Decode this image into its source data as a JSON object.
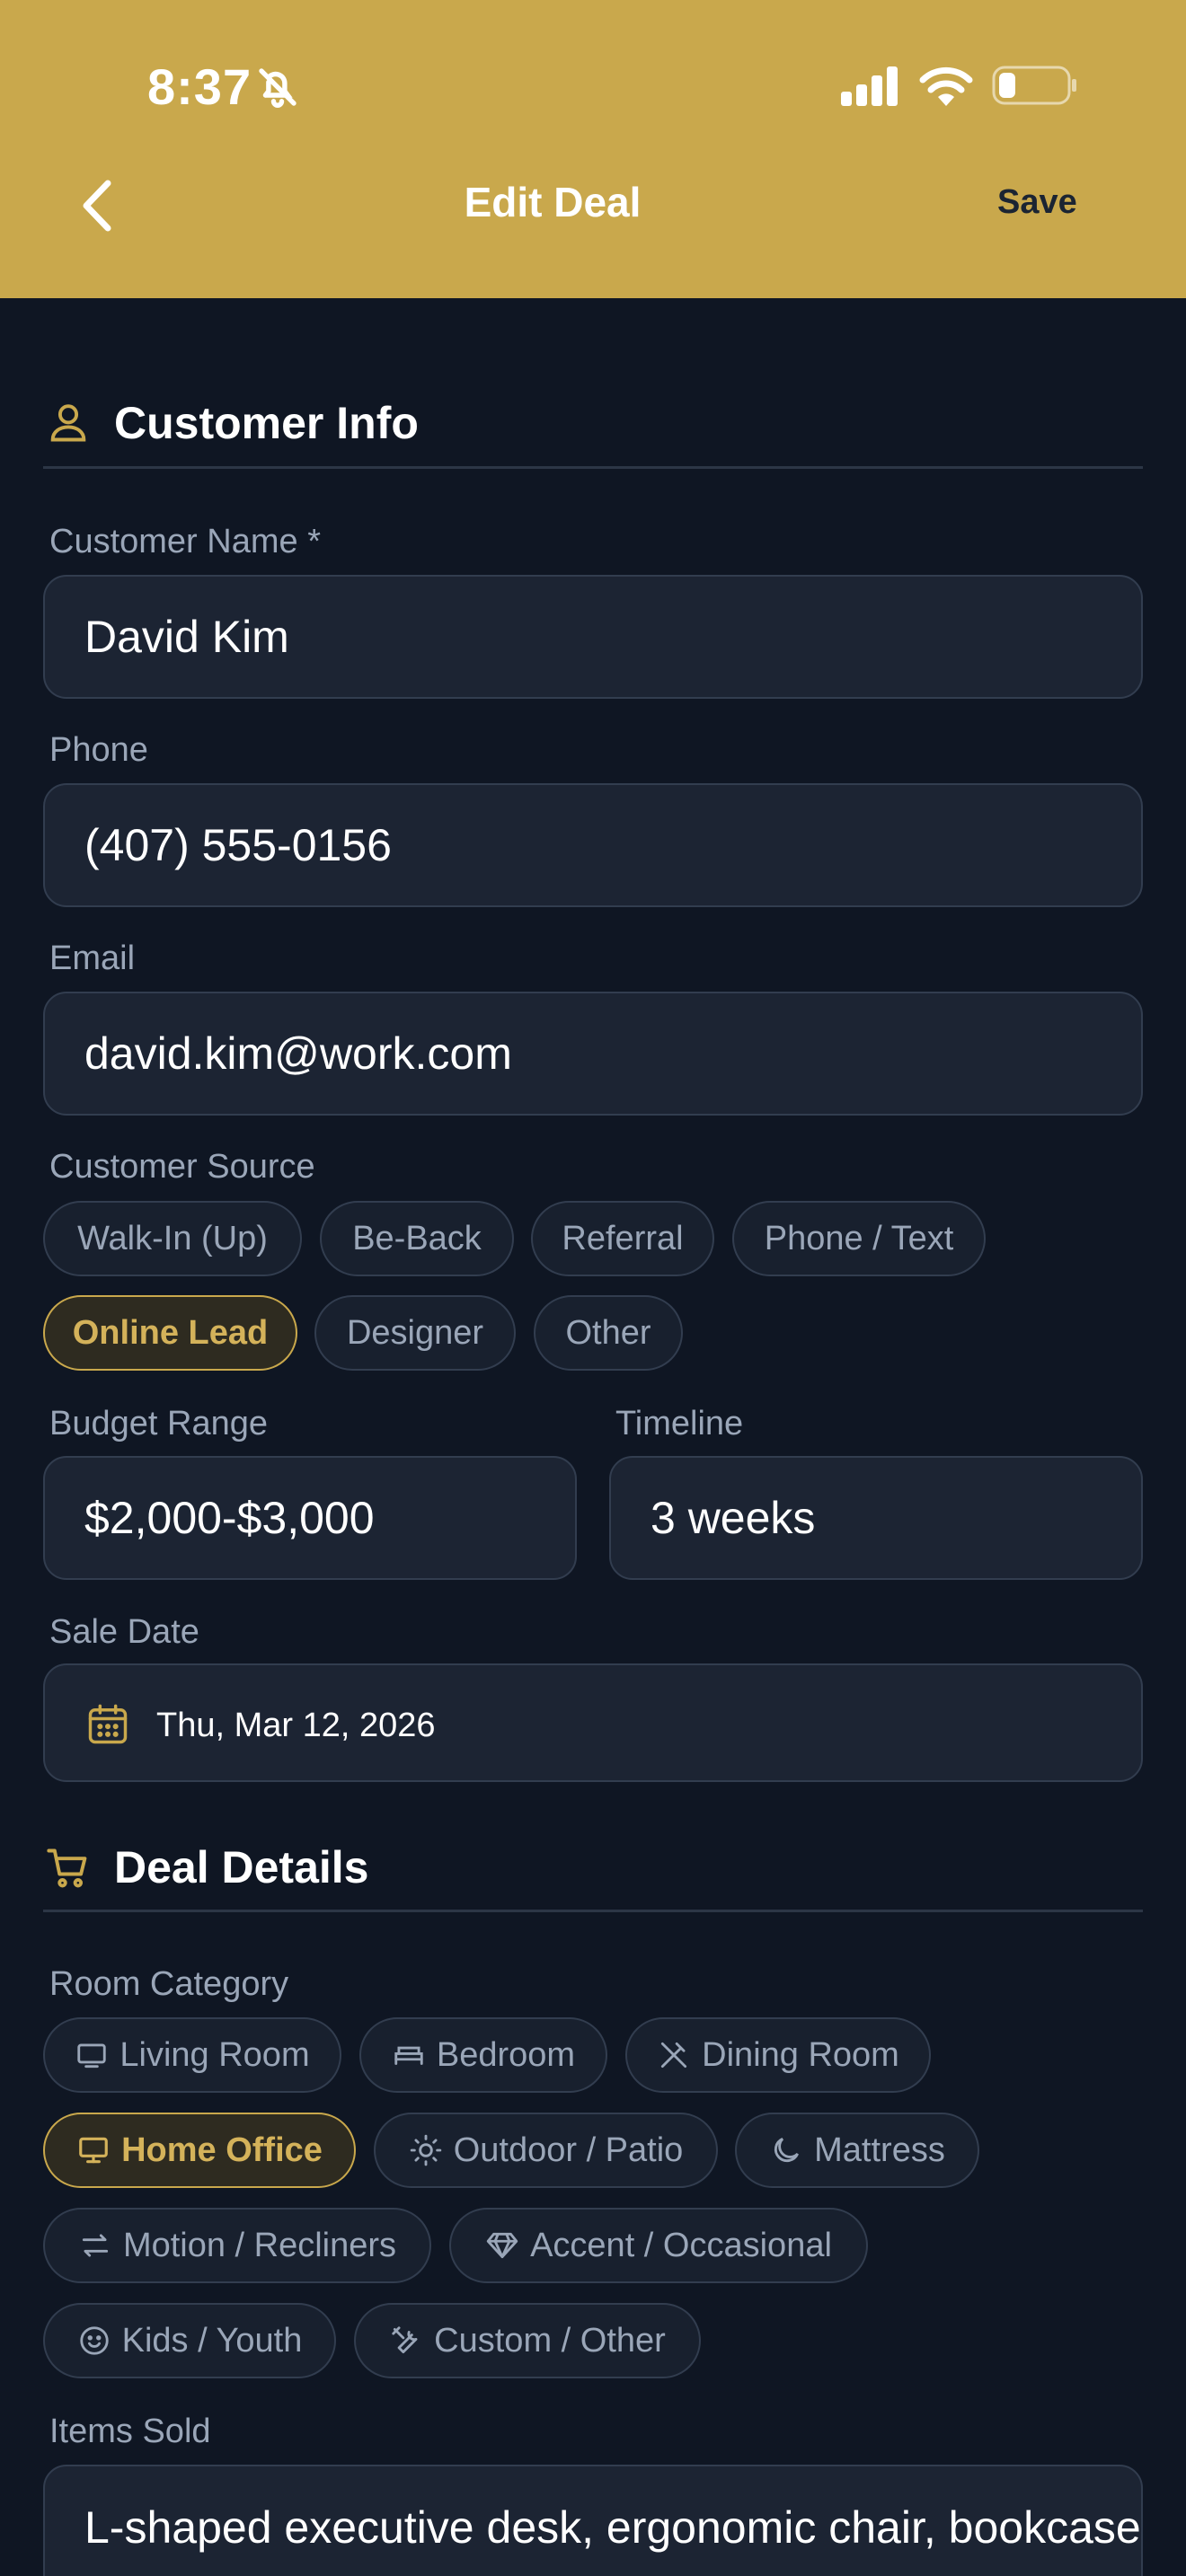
{
  "status_bar": {
    "time": "8:37"
  },
  "header": {
    "title": "Edit Deal",
    "save_label": "Save"
  },
  "customer_info": {
    "title": "Customer Info",
    "name_label": "Customer Name *",
    "name_value": "David Kim",
    "phone_label": "Phone",
    "phone_value": "(407) 555-0156",
    "email_label": "Email",
    "email_value": "david.kim@work.com",
    "source_label": "Customer Source",
    "sources": [
      "Walk-In (Up)",
      "Be-Back",
      "Referral",
      "Phone / Text",
      "Online Lead",
      "Designer",
      "Other"
    ],
    "selected_source": "Online Lead",
    "budget_label": "Budget Range",
    "budget_value": "$2,000-$3,000",
    "timeline_label": "Timeline",
    "timeline_value": "3 weeks",
    "sale_date_label": "Sale Date",
    "sale_date_value": "Thu, Mar 12, 2026"
  },
  "deal_details": {
    "title": "Deal Details",
    "room_category_label": "Room Category",
    "rooms": [
      {
        "label": "Living Room",
        "icon": "tv-icon"
      },
      {
        "label": "Bedroom",
        "icon": "bed-icon"
      },
      {
        "label": "Dining Room",
        "icon": "utensils-icon"
      },
      {
        "label": "Home Office",
        "icon": "monitor-icon"
      },
      {
        "label": "Outdoor / Patio",
        "icon": "sun-icon"
      },
      {
        "label": "Mattress",
        "icon": "moon-icon"
      },
      {
        "label": "Motion / Recliners",
        "icon": "arrows-icon"
      },
      {
        "label": "Accent / Occasional",
        "icon": "gem-icon"
      },
      {
        "label": "Kids / Youth",
        "icon": "smile-icon"
      },
      {
        "label": "Custom / Other",
        "icon": "tools-icon"
      }
    ],
    "selected_room": "Home Office",
    "items_sold_label": "Items Sold",
    "items_sold_value": "L-shaped executive desk, ergonomic chair, bookcase"
  },
  "colors": {
    "accent": "#c9a84c",
    "background": "#0f1623",
    "field": "#1c2433"
  }
}
